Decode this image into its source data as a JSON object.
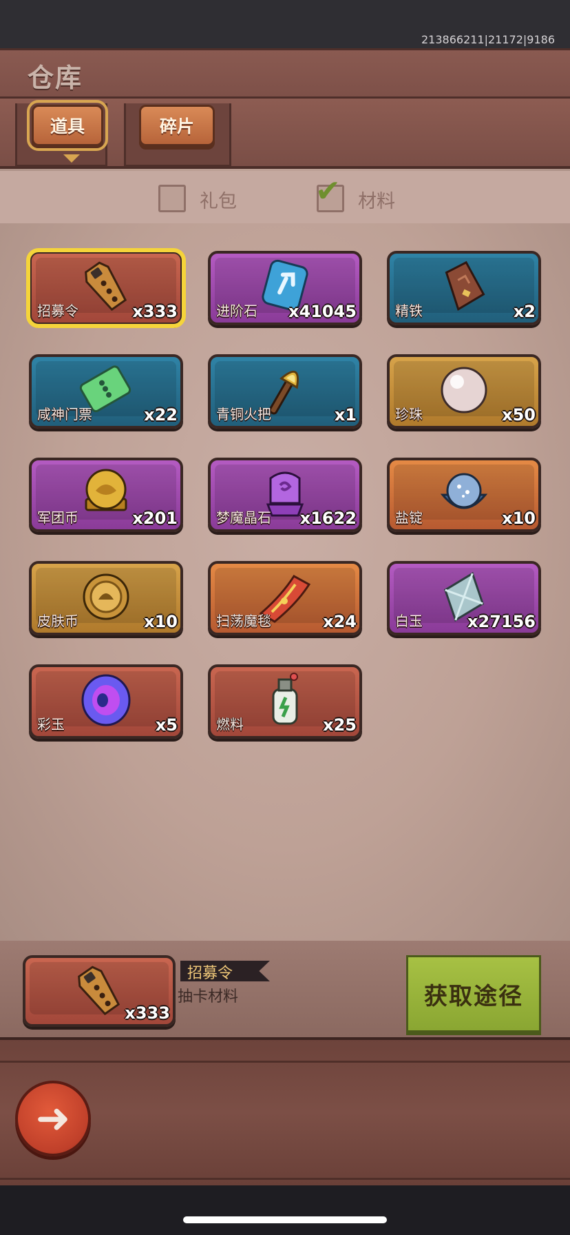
{
  "debug": "213866211|21172|9186",
  "title": "仓库",
  "tabs": [
    {
      "label": "道具",
      "active": true
    },
    {
      "label": "碎片",
      "active": false
    }
  ],
  "filters": [
    {
      "label": "礼包",
      "checked": false
    },
    {
      "label": "材料",
      "checked": true
    }
  ],
  "items": [
    {
      "name": "招募令",
      "count": "x333",
      "rarity": "red",
      "icon": "coffin-token-icon"
    },
    {
      "name": "进阶石",
      "count": "x41045",
      "rarity": "purple",
      "icon": "rune-stone-icon"
    },
    {
      "name": "精铁",
      "count": "x2",
      "rarity": "blue",
      "icon": "iron-ingot-icon"
    },
    {
      "name": "咸神门票",
      "count": "x22",
      "rarity": "blue",
      "icon": "ticket-icon"
    },
    {
      "name": "青铜火把",
      "count": "x1",
      "rarity": "blue",
      "icon": "torch-icon"
    },
    {
      "name": "珍珠",
      "count": "x50",
      "rarity": "gold",
      "icon": "pearl-icon"
    },
    {
      "name": "军团币",
      "count": "x201",
      "rarity": "purple",
      "icon": "legion-coin-icon"
    },
    {
      "name": "梦魔晶石",
      "count": "x1622",
      "rarity": "purple",
      "icon": "crystal-icon"
    },
    {
      "name": "盐锭",
      "count": "x10",
      "rarity": "orange",
      "icon": "salt-ingot-icon"
    },
    {
      "name": "皮肤币",
      "count": "x10",
      "rarity": "gold",
      "icon": "skin-coin-icon"
    },
    {
      "name": "扫荡魔毯",
      "count": "x24",
      "rarity": "orange",
      "icon": "magic-carpet-icon"
    },
    {
      "name": "白玉",
      "count": "x27156",
      "rarity": "purple",
      "icon": "white-jade-icon"
    },
    {
      "name": "彩玉",
      "count": "x5",
      "rarity": "red",
      "icon": "rainbow-jade-icon"
    },
    {
      "name": "燃料",
      "count": "x25",
      "rarity": "red",
      "icon": "fuel-bottle-icon"
    }
  ],
  "selected": {
    "name": "招募令",
    "count": "x333",
    "desc": "抽卡材料",
    "icon": "coffin-token-icon"
  },
  "get_button": "获取途径",
  "back_icon": "back-arrow-icon",
  "colors": {
    "red": "#a2473a",
    "purple": "#8a3b98",
    "blue": "#215f7b",
    "gold": "#b07a2c",
    "orange": "#b75a31",
    "selected_outline": "#f5d43a",
    "get_button": "#a7c144"
  }
}
